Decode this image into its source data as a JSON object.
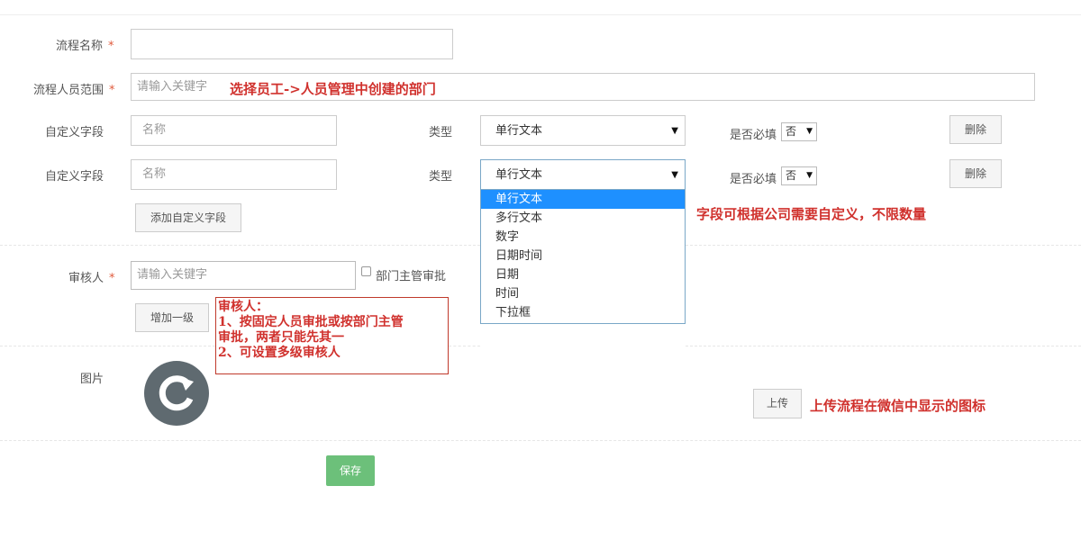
{
  "form": {
    "flow_name_label": "流程名称",
    "required_mark": "*",
    "scope_label": "流程人员范围",
    "scope_placeholder": "请输入关键字",
    "custom_field_label": "自定义字段",
    "custom_fields": [
      {
        "name_placeholder": "名称",
        "type_label": "类型",
        "type_value": "单行文本",
        "required_label": "是否必填",
        "required_value": "否",
        "delete_label": "删除"
      },
      {
        "name_placeholder": "名称",
        "type_label": "类型",
        "type_value": "单行文本",
        "required_label": "是否必填",
        "required_value": "否",
        "delete_label": "删除"
      }
    ],
    "add_field_label": "添加自定义字段",
    "type_options": [
      "单行文本",
      "多行文本",
      "数字",
      "日期时间",
      "日期",
      "时间",
      "下拉框"
    ],
    "approver_label": "审核人",
    "approver_placeholder": "请输入关键字",
    "dept_head_label": "部门主管审批",
    "add_level_label": "增加一级",
    "image_label": "图片",
    "upload_label": "上传",
    "save_label": "保存"
  },
  "annotations": {
    "scope_note": "选择员工->人员管理中创建的部门",
    "field_note": "字段可根据公司需要自定义，不限数量",
    "approver_note_lines": [
      "审核人：",
      "1、按固定人员审批或按部门主管",
      "审批，两者只能先其一",
      "2、可设置多级审核人"
    ],
    "upload_note": "上传流程在微信中显示的图标"
  },
  "colors": {
    "required": "#e05a3c",
    "annotation": "#d0312d",
    "save_button": "#6cc07a",
    "dropdown_selected": "#1e90ff",
    "icon": "#5f6a70"
  },
  "icons": {
    "image_placeholder": "refresh-icon"
  }
}
